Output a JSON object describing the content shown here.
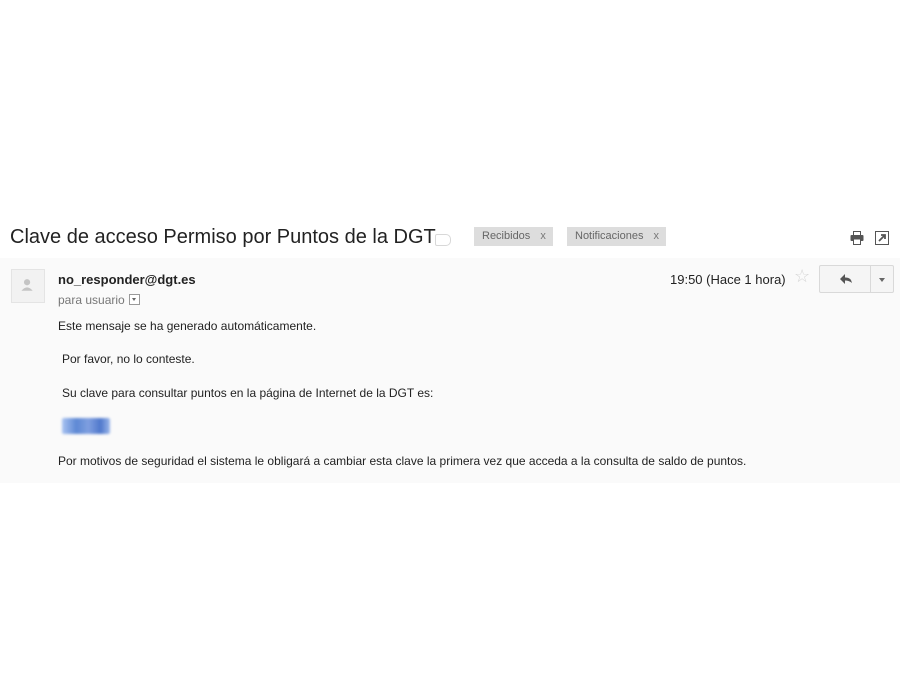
{
  "subject": "Clave de acceso Permiso por Puntos de la DGT",
  "labels": [
    {
      "name": "Recibidos",
      "remove": "x"
    },
    {
      "name": "Notificaciones",
      "remove": "x"
    }
  ],
  "toolbar_icons": [
    "print-icon",
    "new-window-icon"
  ],
  "message": {
    "sender": "no_responder@dgt.es",
    "recipient_line": "para usuario",
    "date": "19:50 (Hace 1 hora)",
    "body": {
      "line1": "Este mensaje se ha generado automáticamente.",
      "line2": "Por favor, no lo conteste.",
      "line3": "Su clave para consultar puntos en la página de Internet de la DGT es:",
      "line5": "Por motivos de seguridad el sistema le obligará a cambiar esta clave la primera vez que acceda a la consulta de saldo de puntos."
    }
  },
  "colors": {
    "label_bg": "#dddddd",
    "message_bg": "#fafafa",
    "redaction": "#5d88d4"
  }
}
